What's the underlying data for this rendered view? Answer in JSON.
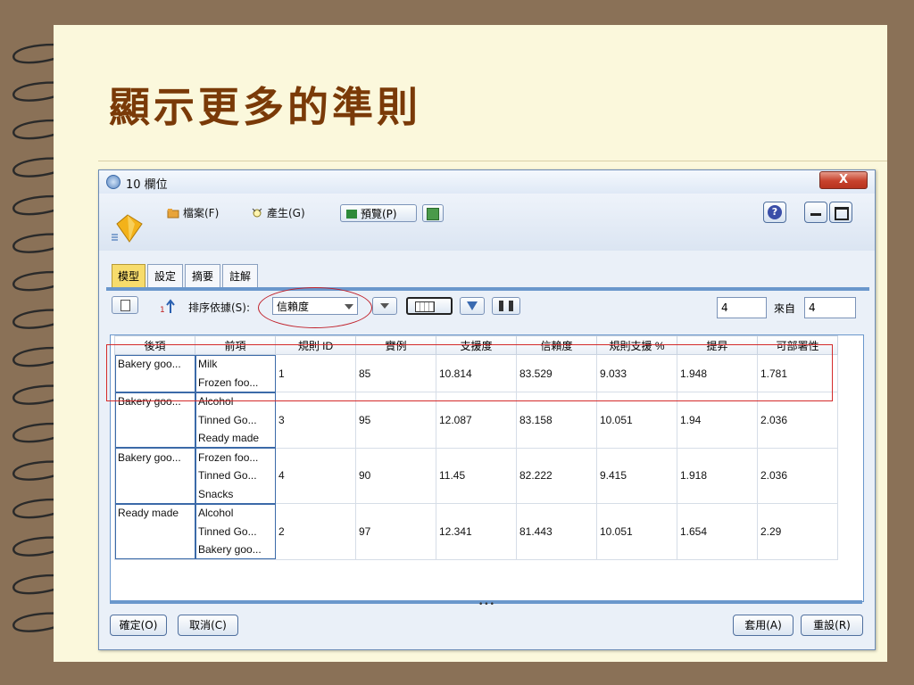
{
  "slide": {
    "title": "顯示更多的準則"
  },
  "window": {
    "title": "10 欄位",
    "close_glyph": "X",
    "menu": [
      {
        "label": "檔案(F)",
        "icon": "folder-icon"
      },
      {
        "label": "產生(G)",
        "icon": "generate-icon"
      }
    ],
    "preview_label": "預覽(P)",
    "tabs": [
      "模型",
      "設定",
      "摘要",
      "註解"
    ],
    "active_tab": "模型",
    "sort": {
      "label": "排序依據(S):",
      "value": "信賴度"
    },
    "range": {
      "show_value": "4",
      "from_label": "來自",
      "from_value": "4"
    },
    "table": {
      "headers": [
        "後項",
        "前項",
        "規則 ID",
        "實例",
        "支援度",
        "信賴度",
        "規則支援 %",
        "提昇",
        "可部署性"
      ],
      "rows": [
        {
          "consequent": "Bakery goo...",
          "antecedents": [
            "Milk",
            "Frozen foo..."
          ],
          "rule_id": "1",
          "instances": "85",
          "support": "10.814",
          "confidence": "83.529",
          "rule_support": "9.033",
          "lift": "1.948",
          "deployability": "1.781"
        },
        {
          "consequent": "Bakery goo...",
          "antecedents": [
            "Alcohol",
            "Tinned Go...",
            "Ready made"
          ],
          "rule_id": "3",
          "instances": "95",
          "support": "12.087",
          "confidence": "83.158",
          "rule_support": "10.051",
          "lift": "1.94",
          "deployability": "2.036"
        },
        {
          "consequent": "Bakery goo...",
          "antecedents": [
            "Frozen foo...",
            "Tinned Go...",
            "Snacks"
          ],
          "rule_id": "4",
          "instances": "90",
          "support": "11.45",
          "confidence": "82.222",
          "rule_support": "9.415",
          "lift": "1.918",
          "deployability": "2.036"
        },
        {
          "consequent": "Ready made",
          "antecedents": [
            "Alcohol",
            "Tinned Go...",
            "Bakery goo..."
          ],
          "rule_id": "2",
          "instances": "97",
          "support": "12.341",
          "confidence": "81.443",
          "rule_support": "10.051",
          "lift": "1.654",
          "deployability": "2.29"
        }
      ]
    },
    "buttons": {
      "ok": "確定(O)",
      "cancel": "取消(C)",
      "apply": "套用(A)",
      "reset": "重設(R)"
    }
  },
  "colors": {
    "title": "#7a3a08",
    "background": "#8a7157",
    "page": "#fbf8dc",
    "active_tab": "#f7dc6c",
    "highlight": "#d42a2a"
  }
}
